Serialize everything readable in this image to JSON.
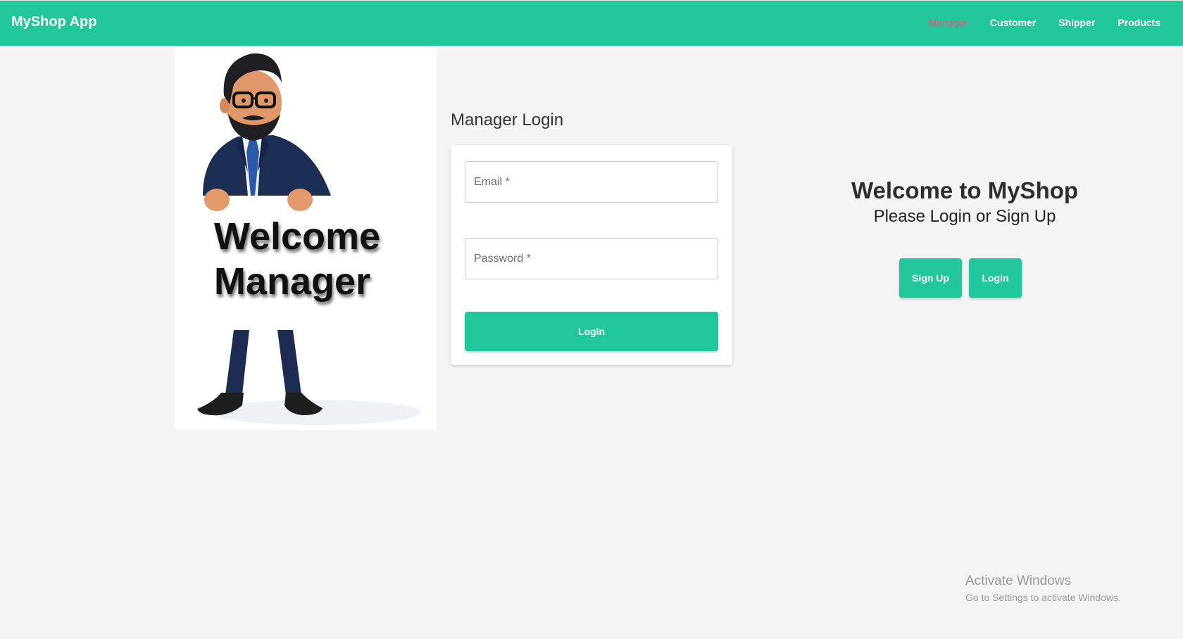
{
  "navbar": {
    "brand": "MyShop App",
    "links": [
      "Manager",
      "Customer",
      "Shipper",
      "Products"
    ],
    "active_link": "Manager",
    "bg_color": "#22c69b",
    "active_color": "#e8547a"
  },
  "hero": {
    "line1": "Welcome",
    "line2": "Manager"
  },
  "login": {
    "title": "Manager Login",
    "email_placeholder": "Email *",
    "password_placeholder": "Password *",
    "submit_label": "Login"
  },
  "welcome": {
    "heading": "Welcome to MyShop",
    "subheading": "Please Login or Sign Up",
    "signup_label": "Sign Up",
    "login_label": "Login"
  },
  "watermark": {
    "title": "Activate Windows",
    "subtitle": "Go to Settings to activate Windows."
  }
}
